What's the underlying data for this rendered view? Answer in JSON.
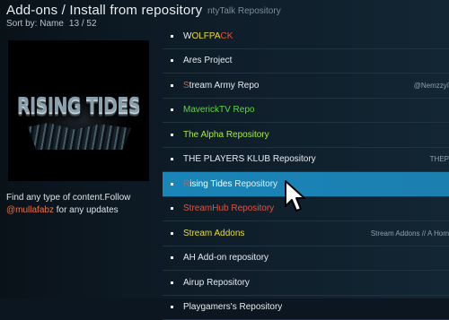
{
  "header": {
    "title": "Add-ons / Install from repository",
    "sort_label": "Sort by: Name",
    "count": "13 / 52"
  },
  "ghost_text": "ntyTalk Repository",
  "fanart": {
    "logo_text": "RISING TIDES"
  },
  "description": {
    "line1": "Find any type of content.Follow",
    "handle": "@mullafabz",
    "line2": " for any updates"
  },
  "repos": [
    {
      "label": "WOLFPACK",
      "extra": "",
      "color": "mixed"
    },
    {
      "label": "Ares Project",
      "extra": "",
      "color": "white"
    },
    {
      "label": "Stream Army Repo",
      "extra": "@Nemzzyï",
      "color": "white"
    },
    {
      "label": "MaverickTV Repo",
      "extra": "",
      "color": "green"
    },
    {
      "label": "The Alpha Repository",
      "extra": "",
      "color": "lime"
    },
    {
      "label": "THE PLAYERS KLUB Repository",
      "extra": "THEP",
      "color": "white"
    },
    {
      "label": "Rising Tides Repository",
      "extra": "",
      "color": "white",
      "selected": true
    },
    {
      "label": "StreamHub Repository",
      "extra": "",
      "color": "red"
    },
    {
      "label": "Stream Addons",
      "extra": "Stream Addons // A Hom",
      "color": "yellow"
    },
    {
      "label": "AH Add-on repository",
      "extra": "",
      "color": "white"
    },
    {
      "label": "Airup Repository",
      "extra": "",
      "color": "white"
    },
    {
      "label": "Playgamers's Repository",
      "extra": "",
      "color": "white"
    }
  ]
}
